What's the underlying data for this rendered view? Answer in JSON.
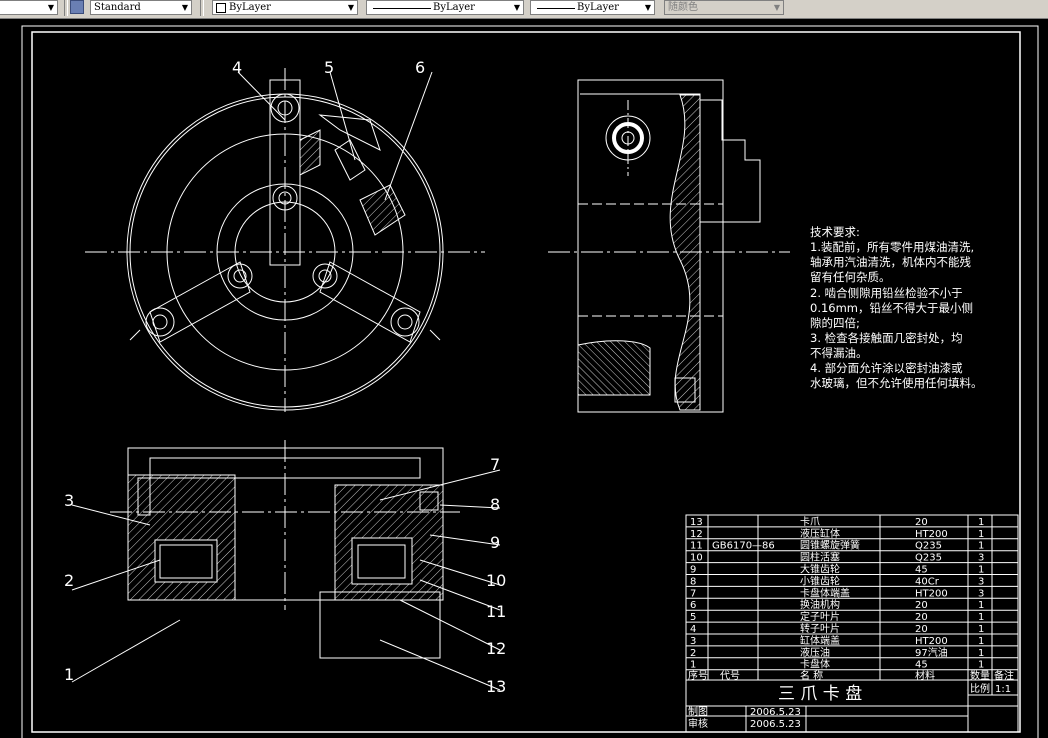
{
  "toolbar": {
    "style_combo": "Standard",
    "layer_combo": "ByLayer",
    "linetype_combo": "ByLayer",
    "lineweight_combo": "ByLayer",
    "color_combo": "随颜色"
  },
  "drawing": {
    "balloons": [
      "1",
      "2",
      "3",
      "4",
      "5",
      "6",
      "7",
      "8",
      "9",
      "10",
      "11",
      "12",
      "13"
    ],
    "requirements": {
      "title": "技术要求:",
      "lines": [
        "1.装配前，所有零件用煤油清洗,",
        "轴承用汽油清洗，机体内不能残",
        "留有任何杂质。",
        "2. 啮合侧隙用铅丝检验不小于",
        "0.16mm，铅丝不得大于最小侧",
        "隙的四倍;",
        "3. 检查各接触面几密封处，均",
        "不得漏油。",
        "4. 部分面允许涂以密封油漆或",
        "水玻璃，但不允许使用任何填料。"
      ]
    },
    "bom": {
      "rows": [
        {
          "no": "13",
          "code": "",
          "name": "卡爪",
          "material": "20",
          "qty": "1",
          "note": ""
        },
        {
          "no": "12",
          "code": "",
          "name": "液压缸体",
          "material": "HT200",
          "qty": "1",
          "note": ""
        },
        {
          "no": "11",
          "code": "GB6170—86",
          "name": "圆锥螺旋弹簧",
          "material": "Q235",
          "qty": "1",
          "note": ""
        },
        {
          "no": "10",
          "code": "",
          "name": "圆柱活塞",
          "material": "Q235",
          "qty": "3",
          "note": ""
        },
        {
          "no": "9",
          "code": "",
          "name": "大锥齿轮",
          "material": "45",
          "qty": "1",
          "note": ""
        },
        {
          "no": "8",
          "code": "",
          "name": "小锥齿轮",
          "material": "40Cr",
          "qty": "3",
          "note": ""
        },
        {
          "no": "7",
          "code": "",
          "name": "卡盘体端盖",
          "material": "HT200",
          "qty": "3",
          "note": ""
        },
        {
          "no": "6",
          "code": "",
          "name": "换油机构",
          "material": "20",
          "qty": "1",
          "note": ""
        },
        {
          "no": "5",
          "code": "",
          "name": "定子叶片",
          "material": "20",
          "qty": "1",
          "note": ""
        },
        {
          "no": "4",
          "code": "",
          "name": "转子叶片",
          "material": "20",
          "qty": "1",
          "note": ""
        },
        {
          "no": "3",
          "code": "",
          "name": "缸体端盖",
          "material": "HT200",
          "qty": "1",
          "note": ""
        },
        {
          "no": "2",
          "code": "",
          "name": "液压油",
          "material": "97汽油",
          "qty": "1",
          "note": ""
        },
        {
          "no": "1",
          "code": "",
          "name": "卡盘体",
          "material": "45",
          "qty": "1",
          "note": ""
        }
      ],
      "header": {
        "no": "序号",
        "code": "代号",
        "name": "名  称",
        "material": "材料",
        "qty": "数量",
        "note": "备注"
      }
    },
    "title_block": {
      "title": "三 爪 卡 盘",
      "scale_label": "比例",
      "scale_value": "1:1",
      "drawn_label": "制图",
      "drawn_date": "2006.5.23",
      "checked_label": "审核",
      "checked_date": "2006.5.23"
    }
  },
  "colors": {
    "background": "#000000",
    "line": "#ffffff",
    "toolbar": "#d4d0c8"
  }
}
